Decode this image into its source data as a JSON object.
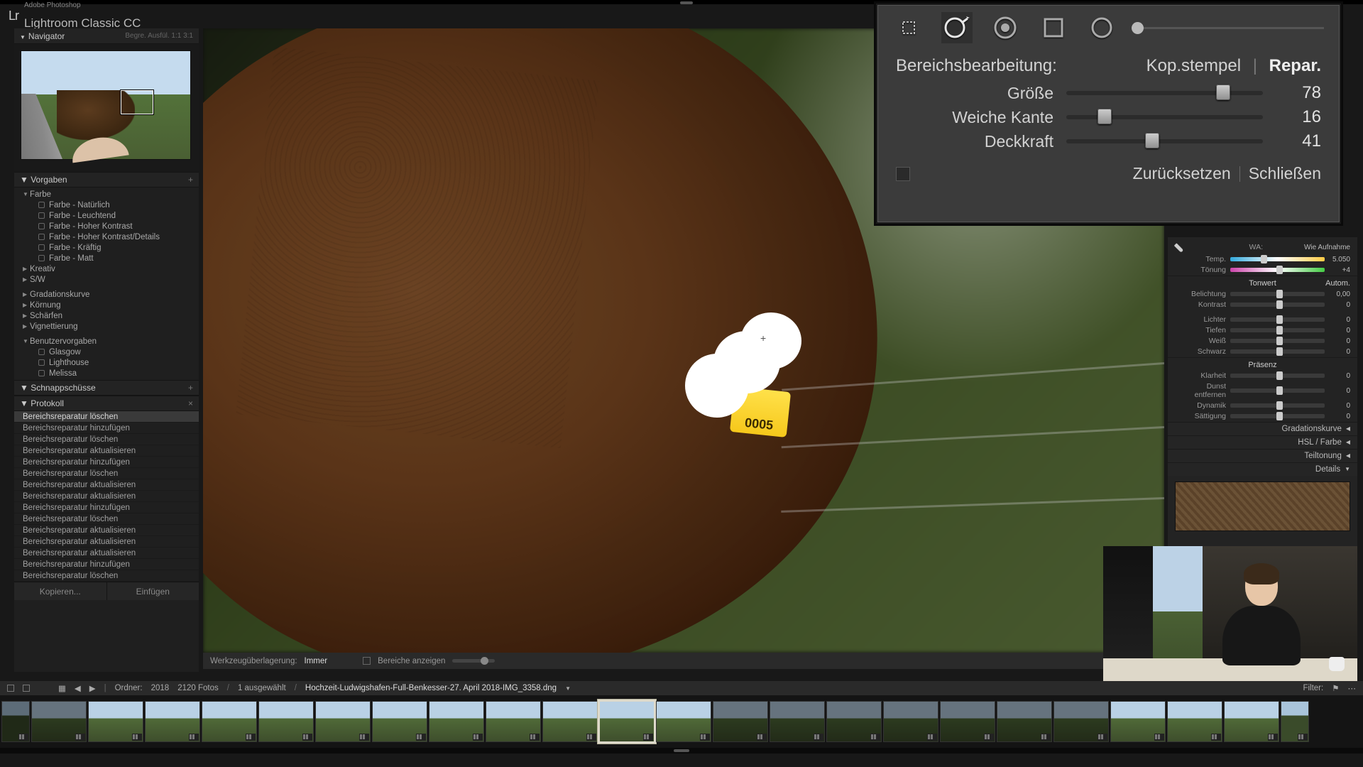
{
  "app": {
    "suite": "Adobe Photoshop",
    "title": "Lightroom Classic CC"
  },
  "navigator": {
    "title": "Navigator",
    "extras": "Begre.   Ausfül.   1:1   3:1"
  },
  "presets": {
    "title": "Vorgaben",
    "groups": {
      "farbe": {
        "label": "Farbe",
        "items": [
          "Farbe - Natürlich",
          "Farbe - Leuchtend",
          "Farbe - Hoher Kontrast",
          "Farbe - Hoher Kontrast/Details",
          "Farbe - Kräftig",
          "Farbe - Matt"
        ]
      },
      "kreativ": "Kreativ",
      "sw": "S/W",
      "grad": "Gradationskurve",
      "korn": "Körnung",
      "scharf": "Schärfen",
      "vign": "Vignettierung",
      "user": {
        "label": "Benutzervorgaben",
        "items": [
          "Glasgow",
          "Lighthouse",
          "Melissa"
        ]
      }
    }
  },
  "snapshots": {
    "title": "Schnappschüsse"
  },
  "history": {
    "title": "Protokoll",
    "items": [
      "Bereichsreparatur löschen",
      "Bereichsreparatur hinzufügen",
      "Bereichsreparatur löschen",
      "Bereichsreparatur aktualisieren",
      "Bereichsreparatur hinzufügen",
      "Bereichsreparatur löschen",
      "Bereichsreparatur aktualisieren",
      "Bereichsreparatur aktualisieren",
      "Bereichsreparatur hinzufügen",
      "Bereichsreparatur löschen",
      "Bereichsreparatur aktualisieren",
      "Bereichsreparatur aktualisieren",
      "Bereichsreparatur aktualisieren",
      "Bereichsreparatur hinzufügen",
      "Bereichsreparatur löschen"
    ]
  },
  "left_buttons": {
    "copy": "Kopieren...",
    "paste": "Einfügen"
  },
  "overlay_toolbar": {
    "label": "Werkzeugüberlagerung:",
    "mode": "Immer",
    "show": "Bereiche anzeigen"
  },
  "spot_panel": {
    "title": "Bereichsbearbeitung:",
    "mode_clone": "Kop.stempel",
    "mode_heal": "Repar.",
    "sliders": {
      "size": {
        "label": "Größe",
        "value": 78,
        "pct": 76
      },
      "feather": {
        "label": "Weiche Kante",
        "value": 16,
        "pct": 18
      },
      "opacity": {
        "label": "Deckkraft",
        "value": 41,
        "pct": 41
      }
    },
    "reset": "Zurücksetzen",
    "close": "Schließen"
  },
  "right_panel": {
    "wb": {
      "label": "WA:",
      "value": "Wie Aufnahme"
    },
    "temp": {
      "label": "Temp.",
      "value": "5.050"
    },
    "tint": {
      "label": "Tönung",
      "value": "+4"
    },
    "tone_header": "Tonwert",
    "auto": "Autom.",
    "exposure": {
      "label": "Belichtung",
      "value": "0,00"
    },
    "contrast": {
      "label": "Kontrast",
      "value": "0"
    },
    "lights": {
      "label": "Lichter",
      "value": "0"
    },
    "darks": {
      "label": "Tiefen",
      "value": "0"
    },
    "white": {
      "label": "Weiß",
      "value": "0"
    },
    "black": {
      "label": "Schwarz",
      "value": "0"
    },
    "presence": "Präsenz",
    "clarity": {
      "label": "Klarheit",
      "value": "0"
    },
    "dehaze": {
      "label": "Dunst entfernen",
      "value": "0"
    },
    "vibrance": {
      "label": "Dynamik",
      "value": "0"
    },
    "saturation": {
      "label": "Sättigung",
      "value": "0"
    },
    "collapsed": {
      "grad": "Gradationskurve",
      "hsl": "HSL / Farbe",
      "split": "Teiltonung",
      "details": "Details"
    }
  },
  "film_info": {
    "folder_label": "Ordner:",
    "folder": "2018",
    "count": "2120 Fotos",
    "selected": "1 ausgewählt",
    "filename": "Hochzeit-Ludwigshafen-Full-Benkesser-27. April 2018-IMG_3358.dng",
    "filter_label": "Filter:"
  },
  "ear_tag": "0005"
}
